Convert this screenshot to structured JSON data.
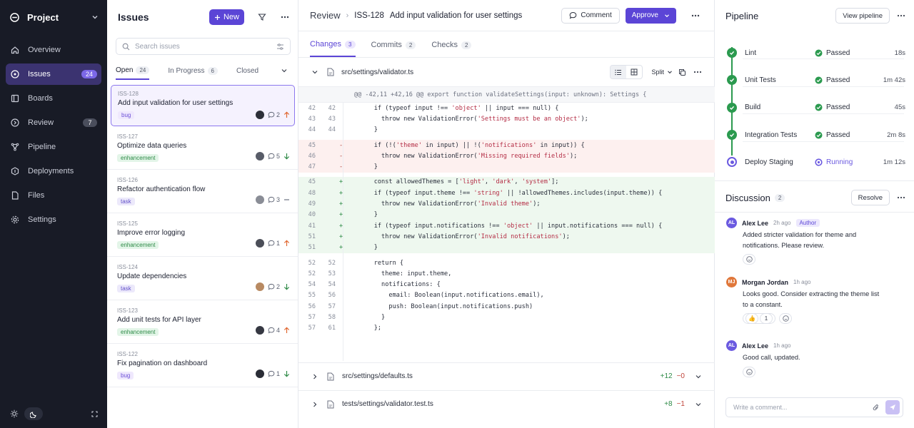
{
  "sidebar": {
    "project": "Project",
    "items": [
      {
        "label": "Overview",
        "badge": ""
      },
      {
        "label": "Issues",
        "badge": "24"
      },
      {
        "label": "Boards",
        "badge": ""
      },
      {
        "label": "Review",
        "badge": "7"
      },
      {
        "label": "Pipeline",
        "badge": ""
      },
      {
        "label": "Deployments",
        "badge": ""
      },
      {
        "label": "Files",
        "badge": ""
      },
      {
        "label": "Settings",
        "badge": ""
      }
    ]
  },
  "issues": {
    "title": "Issues",
    "new_label": "New",
    "search_placeholder": "Search issues",
    "tabs": [
      {
        "label": "Open",
        "count": "24"
      },
      {
        "label": "In Progress",
        "count": "6"
      },
      {
        "label": "Closed",
        "count": ""
      }
    ],
    "list": [
      {
        "id": "ISS-128",
        "title": "Add input validation for user settings",
        "tag": "bug",
        "comments": "2",
        "priority": "up"
      },
      {
        "id": "ISS-127",
        "title": "Optimize data queries",
        "tag": "enhancement",
        "comments": "5",
        "priority": "down"
      },
      {
        "id": "ISS-126",
        "title": "Refactor authentication flow",
        "tag": "task",
        "comments": "3",
        "priority": "none"
      },
      {
        "id": "ISS-125",
        "title": "Improve error logging",
        "tag": "enhancement",
        "comments": "1",
        "priority": "up"
      },
      {
        "id": "ISS-124",
        "title": "Update dependencies",
        "tag": "task",
        "comments": "2",
        "priority": "down"
      },
      {
        "id": "ISS-123",
        "title": "Add unit tests for API layer",
        "tag": "enhancement",
        "comments": "4",
        "priority": "up"
      },
      {
        "id": "ISS-122",
        "title": "Fix pagination on dashboard",
        "tag": "bug",
        "comments": "1",
        "priority": "down"
      }
    ]
  },
  "review": {
    "breadcrumb": "Review",
    "issue_id": "ISS-128",
    "issue_title": "Add input validation for user settings",
    "comment_label": "Comment",
    "approve_label": "Approve",
    "tabs": [
      {
        "label": "Changes",
        "count": "3"
      },
      {
        "label": "Commits",
        "count": "2"
      },
      {
        "label": "Checks",
        "count": "2"
      }
    ],
    "file": "src/settings/validator.ts",
    "view_mode": "Split",
    "hunk": "@@ -42,11 +42,16 @@ export function validateSettings(input: unknown): Settings {",
    "lines": [
      {
        "o": "42",
        "n": "42",
        "s": "",
        "t": "    if (typeof input !== 'object' || input === null) {",
        "k": "ctx"
      },
      {
        "o": "43",
        "n": "43",
        "s": "",
        "t": "      throw new ValidationError('Settings must be an object');",
        "k": "ctx"
      },
      {
        "o": "44",
        "n": "44",
        "s": "",
        "t": "    }",
        "k": "ctx"
      },
      {
        "o": "45",
        "n": "",
        "s": "-",
        "t": "    if (!('theme' in input) || !('notifications' in input)) {",
        "k": "del"
      },
      {
        "o": "46",
        "n": "",
        "s": "-",
        "t": "      throw new ValidationError('Missing required fields');",
        "k": "del"
      },
      {
        "o": "47",
        "n": "",
        "s": "-",
        "t": "    }",
        "k": "del"
      },
      {
        "o": "45",
        "n": "",
        "s": "+",
        "t": "    const allowedThemes = ['light', 'dark', 'system'];",
        "k": "add"
      },
      {
        "o": "48",
        "n": "",
        "s": "+",
        "t": "    if (typeof input.theme !== 'string' || !allowedThemes.includes(input.theme)) {",
        "k": "add"
      },
      {
        "o": "49",
        "n": "",
        "s": "+",
        "t": "      throw new ValidationError('Invalid theme');",
        "k": "add"
      },
      {
        "o": "40",
        "n": "",
        "s": "+",
        "t": "    }",
        "k": "add"
      },
      {
        "o": "41",
        "n": "",
        "s": "+",
        "t": "    if (typeof input.notifications !== 'object' || input.notifications === null) {",
        "k": "add"
      },
      {
        "o": "51",
        "n": "",
        "s": "+",
        "t": "      throw new ValidationError('Invalid notifications');",
        "k": "add"
      },
      {
        "o": "51",
        "n": "",
        "s": "+",
        "t": "    }",
        "k": "add"
      },
      {
        "o": "52",
        "n": "52",
        "s": "",
        "t": "    return {",
        "k": "ctx"
      },
      {
        "o": "52",
        "n": "53",
        "s": "",
        "t": "      theme: input.theme,",
        "k": "ctx"
      },
      {
        "o": "54",
        "n": "54",
        "s": "",
        "t": "      notifications: {",
        "k": "ctx"
      },
      {
        "o": "55",
        "n": "56",
        "s": "",
        "t": "        email: Boolean(input.notifications.email),",
        "k": "ctx"
      },
      {
        "o": "56",
        "n": "57",
        "s": "",
        "t": "        push: Boolean(input.notifications.push)",
        "k": "ctx"
      },
      {
        "o": "57",
        "n": "58",
        "s": "",
        "t": "      }",
        "k": "ctx"
      },
      {
        "o": "57",
        "n": "61",
        "s": "",
        "t": "    };",
        "k": "ctx"
      }
    ],
    "collapsed_files": [
      {
        "name": "src/settings/defaults.ts",
        "add": "+12",
        "del": "−0"
      },
      {
        "name": "tests/settings/validator.test.ts",
        "add": "+8",
        "del": "−1"
      }
    ]
  },
  "pipeline": {
    "title": "Pipeline",
    "view_label": "View pipeline",
    "stages": [
      {
        "name": "Lint",
        "status": "Passed",
        "duration": "18s",
        "state": "passed"
      },
      {
        "name": "Unit Tests",
        "status": "Passed",
        "duration": "1m 42s",
        "state": "passed"
      },
      {
        "name": "Build",
        "status": "Passed",
        "duration": "45s",
        "state": "passed"
      },
      {
        "name": "Integration Tests",
        "status": "Passed",
        "duration": "2m 8s",
        "state": "passed"
      },
      {
        "name": "Deploy Staging",
        "status": "Running",
        "duration": "1m 12s",
        "state": "running"
      }
    ]
  },
  "discussion": {
    "title": "Discussion",
    "count": "2",
    "resolve_label": "Resolve",
    "messages": [
      {
        "initials": "AL",
        "author": "Alex Lee",
        "time": "2h ago",
        "role": "Author",
        "body": "Added stricter validation for theme and notifications. Please review.",
        "reaction": ""
      },
      {
        "initials": "MJ",
        "author": "Morgan Jordan",
        "time": "1h ago",
        "role": "",
        "body": "Looks good. Consider extracting the theme list to a constant.",
        "reaction": "1"
      },
      {
        "initials": "AL",
        "author": "Alex Lee",
        "time": "1h ago",
        "role": "",
        "body": "Good call, updated.",
        "reaction": ""
      }
    ],
    "composer_placeholder": "Write a comment..."
  },
  "colors": {
    "accent": "#5b45d6",
    "passed": "#2b9a4f",
    "running": "#6b5ae0",
    "sidebar": "#181b26"
  }
}
